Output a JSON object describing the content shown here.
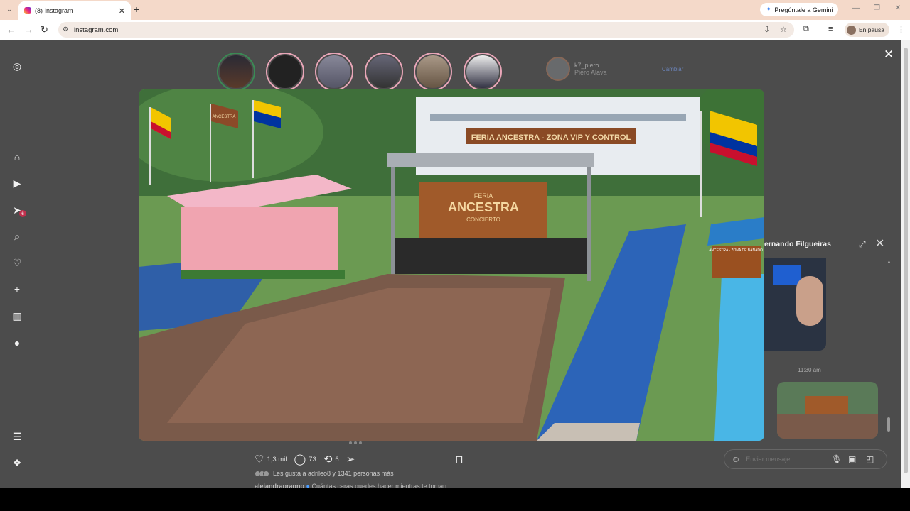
{
  "browser": {
    "tab_title": "(8) Instagram",
    "url": "instagram.com",
    "gemini_label": "Pregúntale a Gemini",
    "profile_status": "En pausa"
  },
  "sidebar": {
    "icons": [
      "instagram-logo-icon",
      "home-icon",
      "reels-icon",
      "messages-icon",
      "search-icon",
      "notifications-icon",
      "create-icon",
      "stats-icon",
      "profile-icon",
      "menu-icon",
      "more-apps-icon"
    ],
    "notif_count": "6"
  },
  "suggestion": {
    "username": "k7_piero",
    "name": "Piero Alava",
    "action": "Cambiar"
  },
  "post": {
    "likes": "1,3 mil",
    "comments": "73",
    "reposts": "6",
    "liked_by": "Les gusta a adrileo8 y 1341 personas más",
    "caption_user": "alejandrapragno",
    "caption_text": "Cuántas caras puedes hacer mientras te toman",
    "image_sign_1": "FERIA ANCESTRA - ZONA VIP Y CONTROL",
    "image_sign_2": "FERIA",
    "image_sign_3": "ANCESTRA",
    "image_sign_4": "CONCIERTO",
    "image_banner": "ANCESTRA",
    "image_tent": "ANCESTRA - ZONA DE BAÑADO"
  },
  "chat": {
    "name": "ernando Filgueiras",
    "time": "11:30 am",
    "input_placeholder": "Enviar mensaje..."
  },
  "colors": {
    "page_bg": "#4c4c4c",
    "tabbar": "#f4d9c9",
    "story_ring": "#e9a6b8"
  }
}
